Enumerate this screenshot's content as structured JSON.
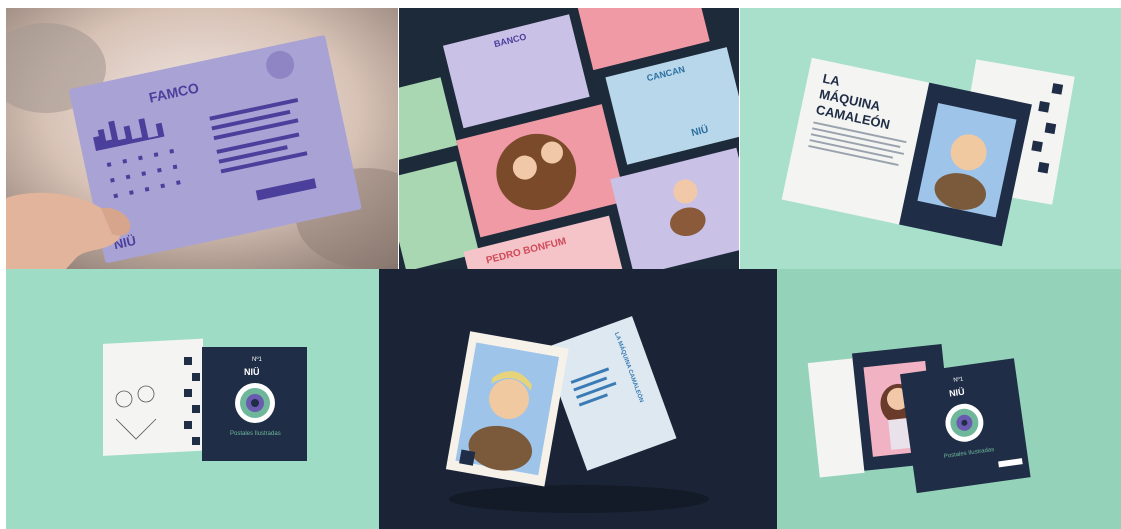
{
  "collage": {
    "postcard_hand": {
      "artist_name": "FAMCO",
      "logo_text": "NIÜ",
      "colors": {
        "card": "#a9a2d4",
        "ink": "#4b3f9c",
        "bg": "#c9b7a9"
      }
    },
    "postcard_grid": {
      "names": [
        "BANCO",
        "CANCAN",
        "PEDRO BONFUM"
      ],
      "logo_text": "NIÜ",
      "colors": {
        "bg": "#1d2a3a",
        "pink": "#ef9aa5",
        "lilac": "#c9c1e6",
        "green": "#a8d7b2",
        "blue": "#b9d7ea"
      }
    },
    "magazine_open": {
      "title_line1": "LA",
      "title_line2": "MÁQUINA",
      "title_line3": "CAMALEÓN",
      "colors": {
        "bg": "#a8e0cc",
        "cover": "#1f2d46",
        "page": "#f4f4f2"
      }
    },
    "magazine_cover": {
      "issue": "Nº1",
      "brand": "NIÜ",
      "subtitle": "Postales Ilustradas",
      "colors": {
        "bg": "#9fdcc6",
        "cover": "#1f2d46",
        "eye_outer": "#6eb79a",
        "eye_inner": "#6a5bb0"
      }
    },
    "floating_cards": {
      "card_title": "LA MÁQUINA CAMALEÓN",
      "colors": {
        "bg": "#1b2436",
        "card_front": "#9ec4ea",
        "card_back": "#dde8f0"
      }
    },
    "magazine_pair": {
      "issue": "Nº1",
      "brand": "NIÜ",
      "subtitle": "Postales Ilustradas",
      "colors": {
        "bg": "#94d3b9",
        "cover": "#1f2d46",
        "portrait_bg": "#f1b2c4"
      }
    }
  }
}
